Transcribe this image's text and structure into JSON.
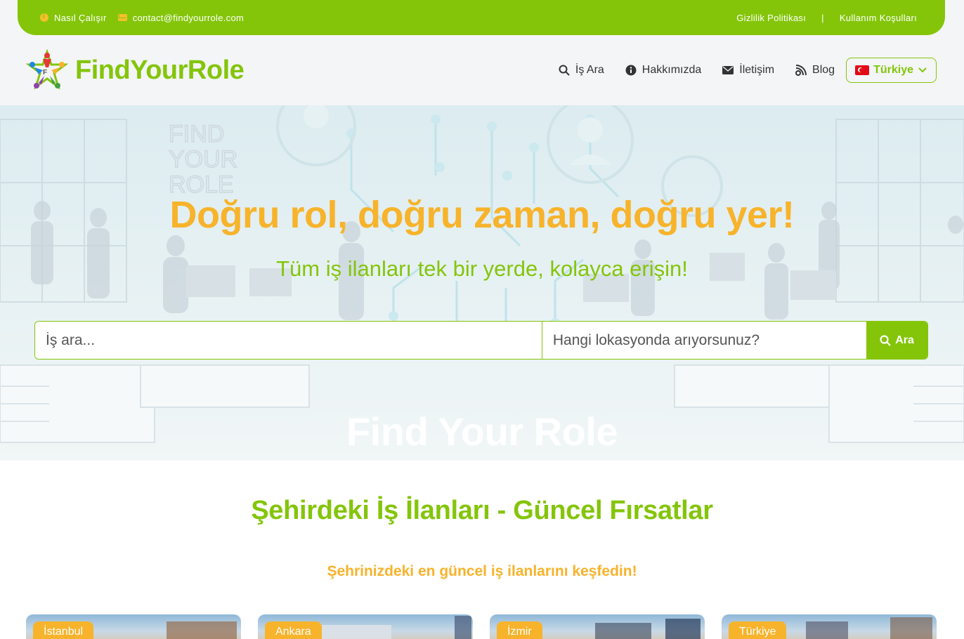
{
  "topbar": {
    "how_it_works": "Nasıl Çalışır",
    "email": "contact@findyourrole.com",
    "privacy": "Gizlilik Politikası",
    "separator": "|",
    "terms": "Kullanım Koşulları"
  },
  "header": {
    "brand": "FindYourRole",
    "nav": {
      "search_jobs": "İş Ara",
      "about": "Hakkımızda",
      "contact": "İletişim",
      "blog": "Blog"
    },
    "country": "Türkiye"
  },
  "hero": {
    "title": "Doğru rol, doğru zaman, doğru yer!",
    "subtitle": "Tüm iş ilanları tek bir yerde, kolayca erişin!",
    "job_placeholder": "İş ara...",
    "location_placeholder": "Hangi lokasyonda arıyorsunuz?",
    "search_button": "Ara",
    "watermark": "Find Your Role"
  },
  "section": {
    "title": "Şehirdeki İş İlanları - Güncel Fırsatlar",
    "subtitle": "Şehrinizdeki en güncel iş ilanlarını keşfedin!",
    "cities": [
      "İstanbul",
      "Ankara",
      "İzmir",
      "Türkiye"
    ]
  },
  "colors": {
    "brand_green": "#84c50a",
    "accent_orange": "#f7b32b"
  }
}
